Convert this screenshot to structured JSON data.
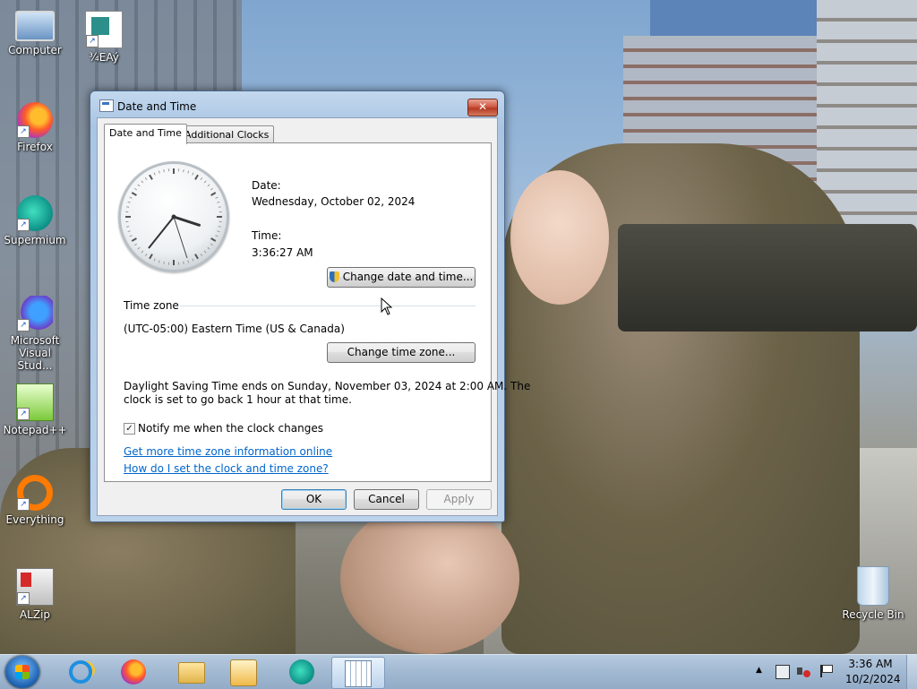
{
  "desktop": {
    "icons": [
      {
        "label": "Computer",
        "icon": "computer-icon"
      },
      {
        "label": "¾EAý",
        "icon": "document-icon"
      },
      {
        "label": "Firefox",
        "icon": "firefox-icon"
      },
      {
        "label": "Supermium",
        "icon": "supermium-icon"
      },
      {
        "label": "Microsoft Visual Stud...",
        "icon": "visual-studio-icon"
      },
      {
        "label": "Notepad++",
        "icon": "notepad-plus-plus-icon"
      },
      {
        "label": "Everything",
        "icon": "everything-icon"
      },
      {
        "label": "ALZip",
        "icon": "alzip-icon"
      },
      {
        "label": "Recycle Bin",
        "icon": "recycle-bin-icon"
      }
    ]
  },
  "dialog": {
    "title": "Date and Time",
    "close_glyph": "✕",
    "tabs": [
      {
        "label": "Date and Time",
        "active": true
      },
      {
        "label": "Additional Clocks",
        "active": false
      }
    ],
    "date_label": "Date:",
    "date_value": "Wednesday, October 02, 2024",
    "time_label": "Time:",
    "time_value": "3:36:27 AM",
    "change_datetime_button": "Change date and time...",
    "timezone_label": "Time zone",
    "timezone_value": "(UTC-05:00) Eastern Time (US & Canada)",
    "change_timezone_button": "Change time zone...",
    "dst_line1": "Daylight Saving Time ends on Sunday, November 03, 2024 at 2:00 AM. The",
    "dst_line2": "clock is set to go back 1 hour at that time.",
    "notify_checkbox_label": "Notify me when the clock changes",
    "notify_checked": true,
    "check_glyph": "✓",
    "link_more_info": "Get more time zone information online",
    "link_how_to": "How do I set the clock and time zone?",
    "ok_button": "OK",
    "cancel_button": "Cancel",
    "apply_button": "Apply",
    "clock": {
      "hours": 3,
      "minutes": 36,
      "seconds": 27
    }
  },
  "taskbar": {
    "pinned": [
      {
        "icon": "internet-explorer-icon"
      },
      {
        "icon": "firefox-icon"
      },
      {
        "icon": "file-explorer-icon"
      },
      {
        "icon": "media-player-icon"
      },
      {
        "icon": "supermium-icon"
      },
      {
        "icon": "date-time-control-panel-icon",
        "active": true
      }
    ],
    "tray": {
      "show_hidden_glyph": "▲",
      "time": "3:36 AM",
      "date": "10/2/2024"
    }
  },
  "colors": {
    "link": "#0066cc",
    "close_button": "#c94a32",
    "taskbar": "#a3bad3"
  }
}
